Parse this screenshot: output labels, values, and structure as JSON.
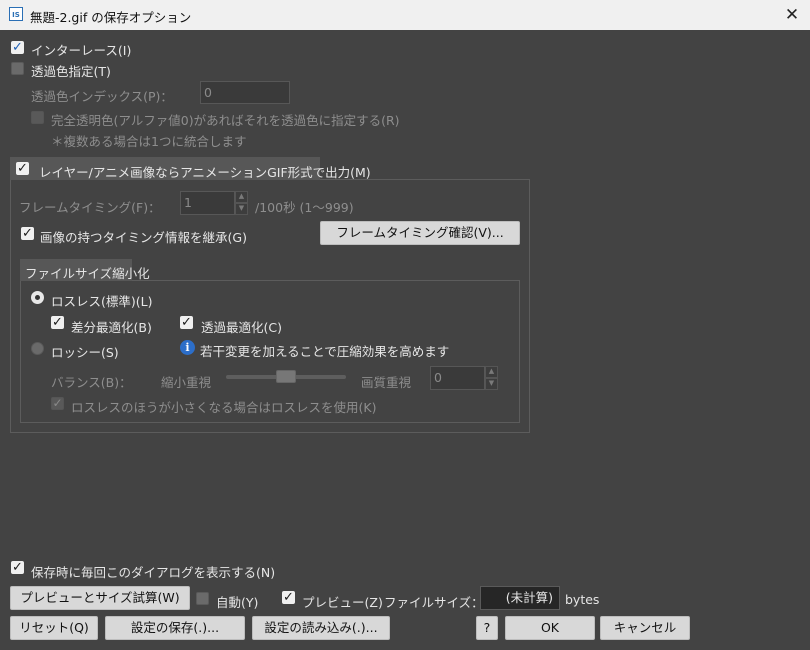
{
  "window": {
    "title": "無題-2.gif の保存オプション",
    "app_icon": "IS",
    "close": "✕"
  },
  "interlace": {
    "label": "インターレース(I)",
    "checked": true
  },
  "transparent": {
    "label": "透過色指定(T)",
    "checked": false
  },
  "trans_index": {
    "label": "透過色インデックス(P)：",
    "value": "0"
  },
  "full_trans": {
    "label": "完全透明色(アルファ値0)があればそれを透過色に指定する(R)"
  },
  "note": "＊複数ある場合は1つに統合します",
  "anim": {
    "label": "レイヤー/アニメ画像ならアニメーションGIF形式で出力(M)",
    "frame_timing_label": "フレームタイミング(F)：",
    "frame_timing_value": "1",
    "frame_unit": "/100秒 (1〜999)",
    "inherit_label": "画像の持つタイミング情報を継承(G)",
    "confirm_btn": "フレームタイミング確認(V)..."
  },
  "reduce": {
    "tab": "ファイルサイズ縮小化",
    "lossless": "ロスレス(標準)(L)",
    "diff_opt": "差分最適化(B)",
    "trans_opt": "透過最適化(C)",
    "lossy": "ロッシー(S)",
    "info_text": "若干変更を加えることで圧縮効果を高めます",
    "balance": "バランス(B)：",
    "shrink_pref": "縮小重視",
    "quality_pref": "画質重視",
    "quality_value": "0",
    "slider_level": 0.5,
    "use_lossless": "ロスレスのほうが小さくなる場合はロスレスを使用(K)"
  },
  "show_dialog": "保存時に毎回このダイアログを表示する(N)",
  "bottom": {
    "preview_btn": "プレビューとサイズ試算(W)",
    "auto": "自動(Y)",
    "preview": "プレビュー(Z)",
    "filesize_label": "ファイルサイズ：",
    "filesize_value": "(未計算)",
    "bytes": "bytes",
    "reset": "リセット(Q)",
    "save_settings": "設定の保存(.)...",
    "load_settings": "設定の読み込み(.)...",
    "help": "?",
    "ok": "OK",
    "cancel": "キャンセル"
  }
}
